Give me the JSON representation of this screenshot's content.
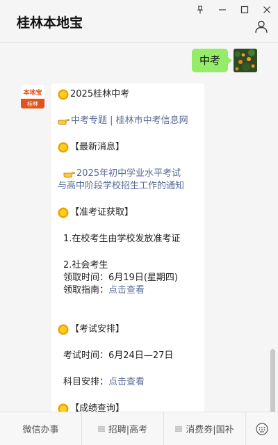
{
  "window": {
    "title": "桂林本地宝"
  },
  "icons": {
    "pin": "pin-icon",
    "minimize": "minimize-icon",
    "maximize": "maximize-icon",
    "close": "close-icon",
    "profile": "person-icon",
    "keyboard": "keyboard-icon"
  },
  "colors": {
    "outgoing_bubble": "#95ec69",
    "link": "#576b95",
    "brand": "#e2531b"
  },
  "chat": {
    "outgoing": {
      "text": "中考"
    },
    "bot_avatar": {
      "logo_text": "本地宝",
      "logo_sub": "桂林"
    },
    "message": {
      "title": "2025桂林中考",
      "link_topic": "中考专题 | 桂林市中考信息网",
      "latest_heading": "【最新消息】",
      "notice_line1": "2025年初中学业水平考试",
      "notice_line2": "与高中阶段学校招生工作的通知",
      "ticket_heading": "【准考证获取】",
      "ticket_item1": "1.在校考生由学校发放准考证",
      "ticket_item2": "2.社会考生",
      "ticket_time_label": "领取时间：",
      "ticket_time_value": "6月19日(星期四)",
      "ticket_guide_label": "领取指南：",
      "ticket_guide_link": "点击查看",
      "exam_heading": "【考试安排】",
      "exam_time_label": "考试时间：",
      "exam_time_value": "6月24日—27日",
      "subject_label": "科目安排：",
      "subject_link": "点击查看",
      "score_heading": "【成绩查询】"
    }
  },
  "bottom_menu": {
    "items": [
      {
        "label": "微信办事"
      },
      {
        "label": "招聘|高考"
      },
      {
        "label": "消费券|国补"
      }
    ]
  }
}
